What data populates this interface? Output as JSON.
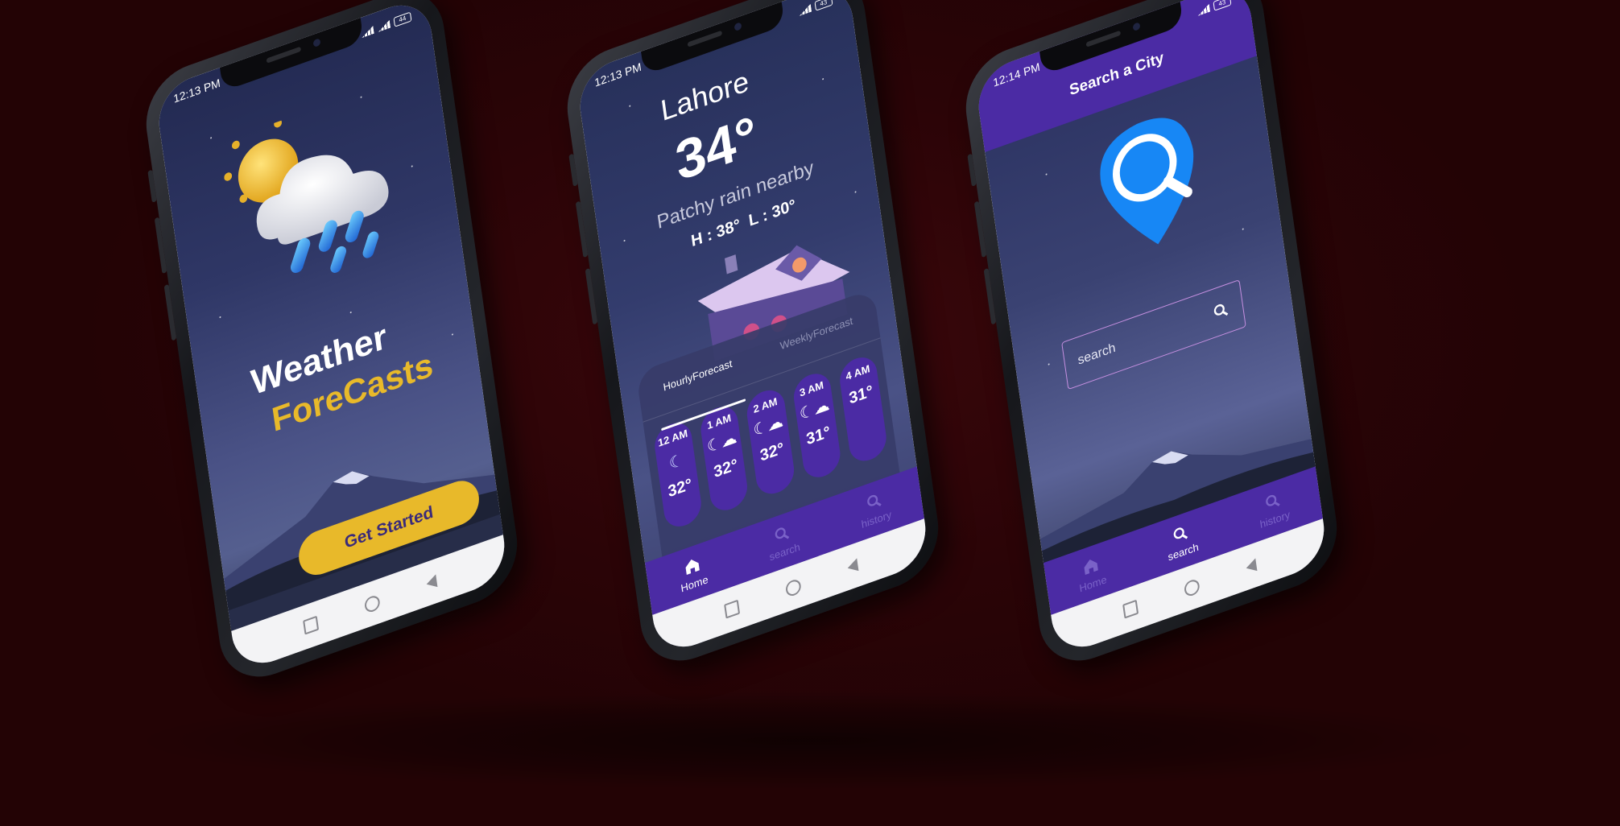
{
  "phone1": {
    "status_time": "12:13 PM",
    "title_line1": "Weather",
    "title_line2": "ForeCasts",
    "get_started_label": "Get Started",
    "colors": {
      "accent": "#e8b92a",
      "title_dark": "#3a2a7a"
    }
  },
  "phone2": {
    "status_time": "12:13 PM",
    "city": "Lahore",
    "temperature": "34°",
    "condition": "Patchy rain nearby",
    "high_low": "H : 38°  L : 30°",
    "tabs": [
      {
        "label": "HourlyForecast",
        "active": true
      },
      {
        "label": "WeeklyForecast",
        "active": false
      }
    ],
    "hourly": [
      {
        "time": "12 AM",
        "icon": "moon-icon",
        "temp": "32°"
      },
      {
        "time": "1 AM",
        "icon": "moon-cloud-icon",
        "temp": "32°"
      },
      {
        "time": "2 AM",
        "icon": "moon-cloud-icon",
        "temp": "32°"
      },
      {
        "time": "3 AM",
        "icon": "moon-cloud-icon",
        "temp": "31°"
      },
      {
        "time": "4 AM",
        "icon": "moon-icon",
        "temp": "31°"
      }
    ],
    "bottom_nav": [
      {
        "label": "Home",
        "icon": "home-icon",
        "active": true
      },
      {
        "label": "search",
        "icon": "search-icon",
        "active": false
      },
      {
        "label": "history",
        "icon": "search-icon",
        "active": false
      }
    ]
  },
  "phone3": {
    "status_time": "12:14 PM",
    "header_title": "Search a City",
    "search_placeholder": "search",
    "bottom_nav": [
      {
        "label": "Home",
        "icon": "home-icon",
        "active": false
      },
      {
        "label": "search",
        "icon": "search-icon",
        "active": true
      },
      {
        "label": "history",
        "icon": "search-icon",
        "active": false
      }
    ]
  },
  "colors": {
    "background": "#2e0508",
    "purple": "#4b2ba4",
    "sky_top": "#232a52"
  }
}
